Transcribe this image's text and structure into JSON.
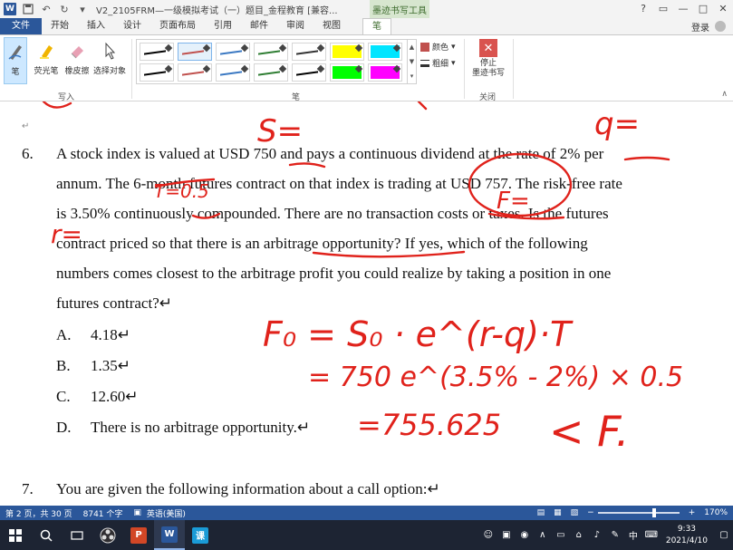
{
  "titlebar": {
    "app_icon": "W",
    "document_title": "V2_2105FRM—一级模拟考试（一）题目_金程教育 [兼容...",
    "contextual_tab_title": "墨迹书写工具",
    "window_controls": [
      "?",
      "▭",
      "—",
      "□",
      "✕"
    ]
  },
  "tabs": {
    "file": "文件",
    "items": [
      "开始",
      "插入",
      "设计",
      "页面布局",
      "引用",
      "邮件",
      "审阅",
      "视图"
    ],
    "active": "笔",
    "login": "登录"
  },
  "ribbon": {
    "write_group": {
      "label": "写入",
      "tools": [
        {
          "label": "笔",
          "icon": "pen-icon",
          "selected": true
        },
        {
          "label": "荧光笔",
          "icon": "highlighter-icon",
          "selected": false
        },
        {
          "label": "橡皮擦",
          "icon": "eraser-icon",
          "selected": false
        },
        {
          "label": "选择对象",
          "icon": "select-pointer-icon",
          "selected": false
        }
      ]
    },
    "pen_group": {
      "label": "笔",
      "color_label": "颜色",
      "thickness_label": "粗细",
      "pen_colors": [
        "#000000",
        "#c0504d",
        "#3a78c2",
        "#2e7d32",
        "#333333",
        "#ffff00",
        "#00e5ff",
        "#000000",
        "#c0504d",
        "#3a78c2",
        "#2e7d32",
        "#000000",
        "#00ff00",
        "#ff00ff"
      ],
      "selected_index": 1
    },
    "close_group": {
      "label": "关闭",
      "stop_label_line1": "停止",
      "stop_label_line2": "墨迹书写"
    }
  },
  "document": {
    "question_number": "6.",
    "question_lines": [
      "A stock index is valued at USD 750 and pays a continuous dividend at the rate of 2% per",
      "annum. The 6-month futures contract on that index is trading at USD 757. The risk-free rate",
      "is 3.50% continuously compounded. There are no transaction costs or taxes. Is the futures",
      "contract priced so that there is an arbitrage opportunity? If yes, which of the following",
      "numbers comes closest to the arbitrage profit you could realize by taking a position in one",
      "futures contract?↵"
    ],
    "options": [
      {
        "letter": "A.",
        "text": "4.18↵"
      },
      {
        "letter": "B.",
        "text": "1.35↵"
      },
      {
        "letter": "C.",
        "text": "12.60↵"
      },
      {
        "letter": "D.",
        "text": "There is no arbitrage opportunity.↵"
      }
    ],
    "next_question_number": "7.",
    "next_question_text": "You are given the following information about a call option:↵",
    "paragraph_mark": "↵",
    "ink_color": "#e0221b",
    "handwriting": {
      "s_eq": "S=",
      "q_eq": "q=",
      "t_eq": "T=0.5",
      "r_eq": "r=",
      "f_eq": "F=",
      "formula_line1": "F₀ = S₀ · e^(r-q)·T",
      "formula_line2": "= 750 e^(3.5% - 2%) × 0.5",
      "formula_line3": "=755.625",
      "comparison": "< F."
    }
  },
  "statusbar": {
    "page_info": "第 2 页，共 30 页",
    "word_count": "8741 个字",
    "language": "英语(美国)",
    "zoom": "170%",
    "zoom_fraction": 0.7
  },
  "taskbar": {
    "apps": [
      {
        "name": "start",
        "icon": "windows-icon",
        "active": false
      },
      {
        "name": "search",
        "icon": "search-icon",
        "active": false
      },
      {
        "name": "task-view",
        "icon": "task-view-icon",
        "active": false
      },
      {
        "name": "obs",
        "icon": "obs-icon",
        "active": false
      },
      {
        "name": "powerpoint",
        "icon": "P",
        "color": "#d24726",
        "active": false
      },
      {
        "name": "word",
        "icon": "W",
        "color": "#2b579a",
        "active": true
      },
      {
        "name": "lesson-app",
        "icon": "课",
        "color": "#1a9bd7",
        "active": false
      }
    ],
    "time": "9:33",
    "date": "2021/4/10",
    "ime": "中"
  }
}
